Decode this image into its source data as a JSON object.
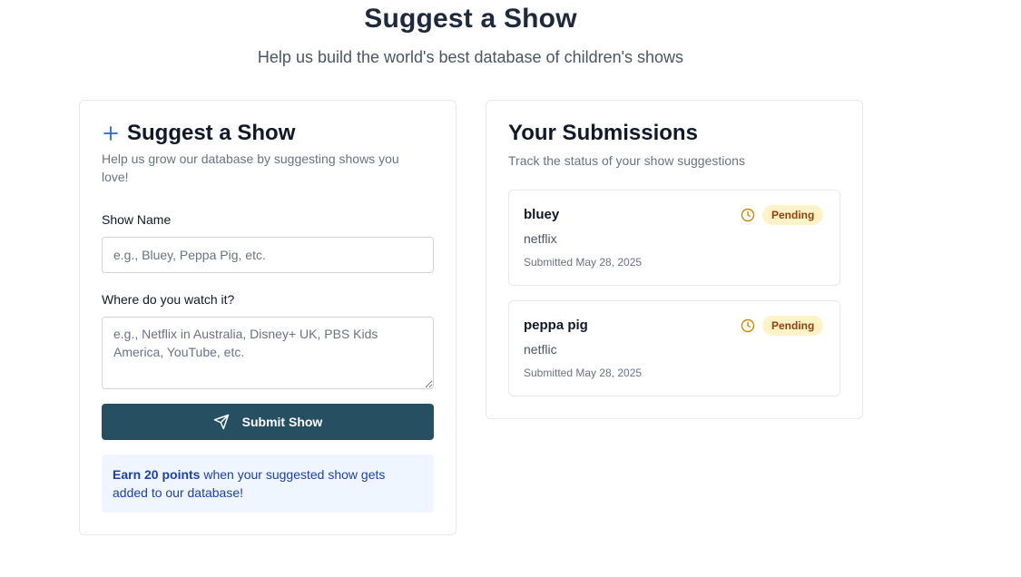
{
  "header": {
    "title": "Suggest a Show",
    "subtitle": "Help us build the world's best database of children's shows"
  },
  "suggest_form": {
    "title": "Suggest a Show",
    "description": "Help us grow our database by suggesting shows you love!",
    "show_name_label": "Show Name",
    "show_name_value": "",
    "show_name_placeholder": "e.g., Bluey, Peppa Pig, etc.",
    "where_label": "Where do you watch it?",
    "where_value": "",
    "where_placeholder": "e.g., Netflix in Australia, Disney+ UK, PBS Kids America, YouTube, etc.",
    "submit_label": "Submit Show",
    "info_strong": "Earn 20 points",
    "info_rest": " when your suggested show gets added to our database!"
  },
  "submissions": {
    "title": "Your Submissions",
    "description": "Track the status of your show suggestions",
    "items": [
      {
        "name": "bluey",
        "platform": "netflix",
        "date": "Submitted May 28, 2025",
        "status": "Pending"
      },
      {
        "name": "peppa pig",
        "platform": "netflic",
        "date": "Submitted May 28, 2025",
        "status": "Pending"
      }
    ]
  },
  "icons": {
    "plus": "plus-icon",
    "send": "send-icon",
    "clock": "clock-icon"
  },
  "colors": {
    "primary_button": "#264f62",
    "accent_blue": "#2563eb",
    "pending_bg": "#fef3c7",
    "pending_text": "#92400e",
    "clock": "#ca8a04"
  }
}
